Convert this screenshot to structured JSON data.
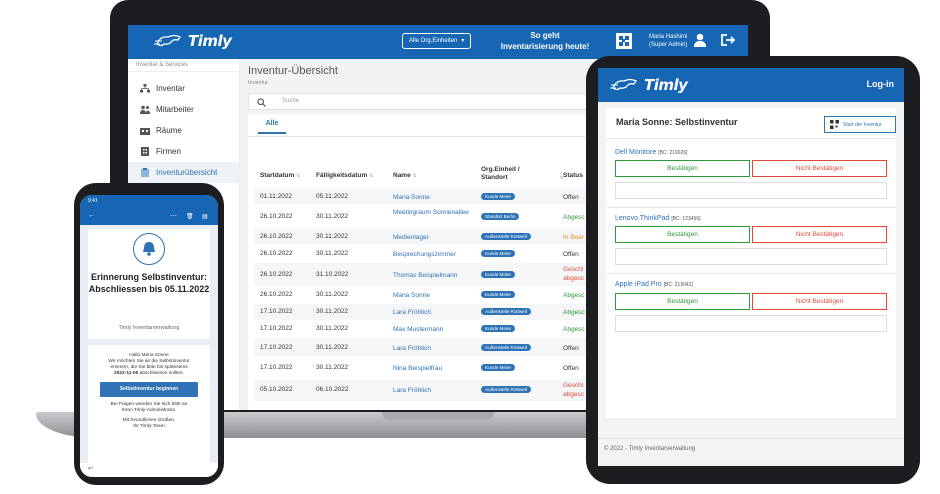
{
  "brand": "Timly",
  "colors": {
    "primary": "#1766b3",
    "link": "#2d73b5",
    "success": "#2e9b3a",
    "warning": "#e89123",
    "danger": "#e14a3a"
  },
  "laptop": {
    "org_button": "Alle Org.Einheiten",
    "slogan_line1": "So geht",
    "slogan_line2": "Inventarisierung heute!",
    "user_name": "Maria Hashimi",
    "user_role": "(Super Admin)",
    "sidebar": {
      "heading": "Inventar & Services",
      "items": [
        {
          "label": "Inventar",
          "icon": "sitemap-icon"
        },
        {
          "label": "Mitarbeiter",
          "icon": "people-icon"
        },
        {
          "label": "Räume",
          "icon": "building-icon"
        },
        {
          "label": "Firmen",
          "icon": "company-icon"
        },
        {
          "label": "Inventurübersicht",
          "icon": "clipboard-icon"
        }
      ]
    },
    "page_title": "Inventur-Übersicht",
    "breadcrumb": "Inventur",
    "search_placeholder": "Suche",
    "tab_all": "Alle",
    "columns": {
      "start": "Startdatum",
      "due": "Fälligkeitsdatum",
      "name": "Name",
      "org_line1": "Org.Einheit /",
      "org_line2": "Standort",
      "status": "Status"
    },
    "rows": [
      {
        "start": "01.11.2022",
        "due": "05.11.2022",
        "name": "Maria Sonne",
        "org": "Kunde Meier",
        "status": "Offen"
      },
      {
        "start": "26.10.2022",
        "due": "30.11.2022",
        "name": "Meetingraum Sonnenallee",
        "org": "Standort Berlin",
        "status": "Abgesc"
      },
      {
        "start": "26.10.2022",
        "due": "30.11.2022",
        "name": "Medienlager",
        "org": "Außenstelle Rottweil",
        "status": "In Bear"
      },
      {
        "start": "26.10.2022",
        "due": "30.11.2022",
        "name": "Besprechungszimmer",
        "org": "Kunde Meier",
        "status": "Offen"
      },
      {
        "start": "26.10.2022",
        "due": "31.10.2022",
        "name": "Thomas Beispielmann",
        "org": "Kunde Meier",
        "status": "Geschl abgesc"
      },
      {
        "start": "26.10.2022",
        "due": "30.11.2022",
        "name": "Maria Sonne",
        "org": "Kunde Meier",
        "status": "Abgesc"
      },
      {
        "start": "17.10.2022",
        "due": "30.11.2022",
        "name": "Lara Fröhlich",
        "org": "Außenstelle Rottweil",
        "status": "Abgesc"
      },
      {
        "start": "17.10.2022",
        "due": "30.11.2022",
        "name": "Max Mustermann",
        "org": "Kunde Meier",
        "status": "Abgesc"
      },
      {
        "start": "17.10.2022",
        "due": "30.11.2022",
        "name": "Lara Fröhlich",
        "org": "Außenstelle Rottweil",
        "status": "Offen"
      },
      {
        "start": "17.10.2022",
        "due": "30.11.2022",
        "name": "Nina Beispielfrau",
        "org": "Kunde Meier",
        "status": "Offen"
      },
      {
        "start": "05.10.2022",
        "due": "06.10.2022",
        "name": "Lara Fröhlich",
        "org": "Außenstelle Rottweil",
        "status": "Geschl abgesc"
      }
    ]
  },
  "phone": {
    "time": "9:41",
    "title": "Erinnerung Selbstinventur: Abschliessen bis 05.11.2022",
    "subtitle": "Timly Inventarverwaltung",
    "greeting": "Hallo Maria Sonne",
    "body_line1": "Wir möchten Sie an die Selbstinventur",
    "body_line2": "erinnern, die Sie bitte bis spätestens",
    "body_date": "2022-11-05",
    "body_line3": "abschliessen sollten.",
    "button": "Selbstinventur beginnen",
    "help_line1": "Bei Fragen wenden Sie sich bitte an",
    "help_line2": "Ihren Timly-Administrator.",
    "closing_line1": "Mit freundlichen Grüßen,",
    "closing_line2": "Ihr Timly-Team"
  },
  "tablet": {
    "login": "Log-in",
    "title": "Maria Sonne: Selbstinventur",
    "start_button": "Start der Inventur",
    "confirm": "Bestätigen",
    "reject": "Nicht Bestätigen",
    "items": [
      {
        "name": "Dell Monitore",
        "code": "[BC: 219026]"
      },
      {
        "name": "Lenovo ThinkPad",
        "code": "[BC: 123456]"
      },
      {
        "name": "Apple iPad Pro",
        "code": "[BC: 219042]"
      }
    ],
    "footer": "© 2022 - Timly Inventarverwaltung"
  }
}
